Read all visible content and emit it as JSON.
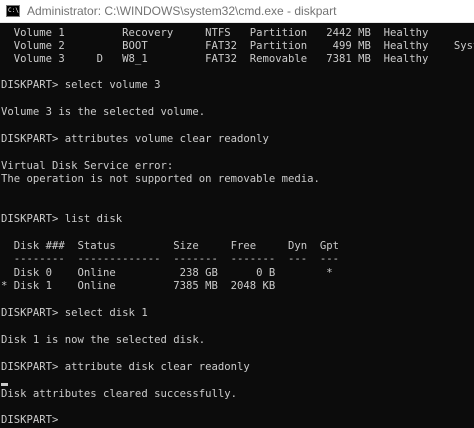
{
  "window": {
    "title": "Administrator: C:\\WINDOWS\\system32\\cmd.exe - diskpart",
    "icon_text": "C:\\"
  },
  "console": {
    "lines": [
      "  Volume 1         Recovery     NTFS   Partition   2442 MB  Healthy",
      "  Volume 2         BOOT         FAT32  Partition    499 MB  Healthy    System",
      "  Volume 3     D   W8_1         FAT32  Removable   7381 MB  Healthy",
      "",
      "DISKPART> select volume 3",
      "",
      "Volume 3 is the selected volume.",
      "",
      "DISKPART> attributes volume clear readonly",
      "",
      "Virtual Disk Service error:",
      "The operation is not supported on removable media.",
      "",
      "",
      "DISKPART> list disk",
      "",
      "  Disk ###  Status         Size     Free     Dyn  Gpt",
      "  --------  -------------  -------  -------  ---  ---",
      "  Disk 0    Online          238 GB      0 B        *",
      "* Disk 1    Online         7385 MB  2048 KB",
      "",
      "DISKPART> select disk 1",
      "",
      "Disk 1 is now the selected disk.",
      "",
      "DISKPART> attribute disk clear readonly",
      "",
      "Disk attributes cleared successfully.",
      "",
      "DISKPART>"
    ]
  },
  "colors": {
    "background": "#0c0c0c",
    "text": "#cccccc",
    "titlebar": "#ffffff",
    "title_text": "#737373"
  }
}
